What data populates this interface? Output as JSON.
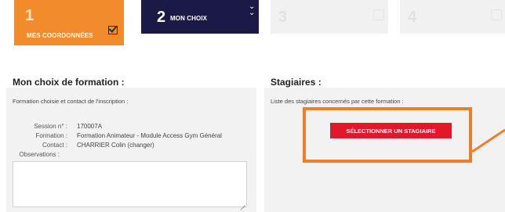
{
  "steps": [
    {
      "number": "1",
      "label": "MES COORDONNÉES",
      "state": "done",
      "icon": "checkbox-checked-icon"
    },
    {
      "number": "2",
      "label": "MON CHOIX",
      "state": "active",
      "icon": "chevron-down-double-icon"
    },
    {
      "number": "3",
      "label": "",
      "state": "disabled",
      "icon": "box-icon"
    },
    {
      "number": "4",
      "label": "",
      "state": "disabled",
      "icon": "box-icon"
    }
  ],
  "left_section": {
    "title": "Mon choix de formation :",
    "subtitle": "Formation choisie et contact de l'inscription :",
    "fields": [
      {
        "label": "Session n° :",
        "value": "170007A"
      },
      {
        "label": "Formation :",
        "value": "Formation Animateur - Module Access Gym Général"
      },
      {
        "label": "Contact :",
        "value": "CHARRIER Colin (changer)"
      },
      {
        "label": "Observations :",
        "value": ""
      }
    ],
    "observations_value": ""
  },
  "right_section": {
    "title": "Stagiaires :",
    "subtitle": "Liste des stagiaires concernés par cette formation :",
    "button_label": "SÉLECTIONNER UN STAGIAIRE"
  },
  "colors": {
    "orange": "#f18b2b",
    "navy": "#1b1a46",
    "red": "#e3172a",
    "highlight": "#ee7e2a"
  }
}
